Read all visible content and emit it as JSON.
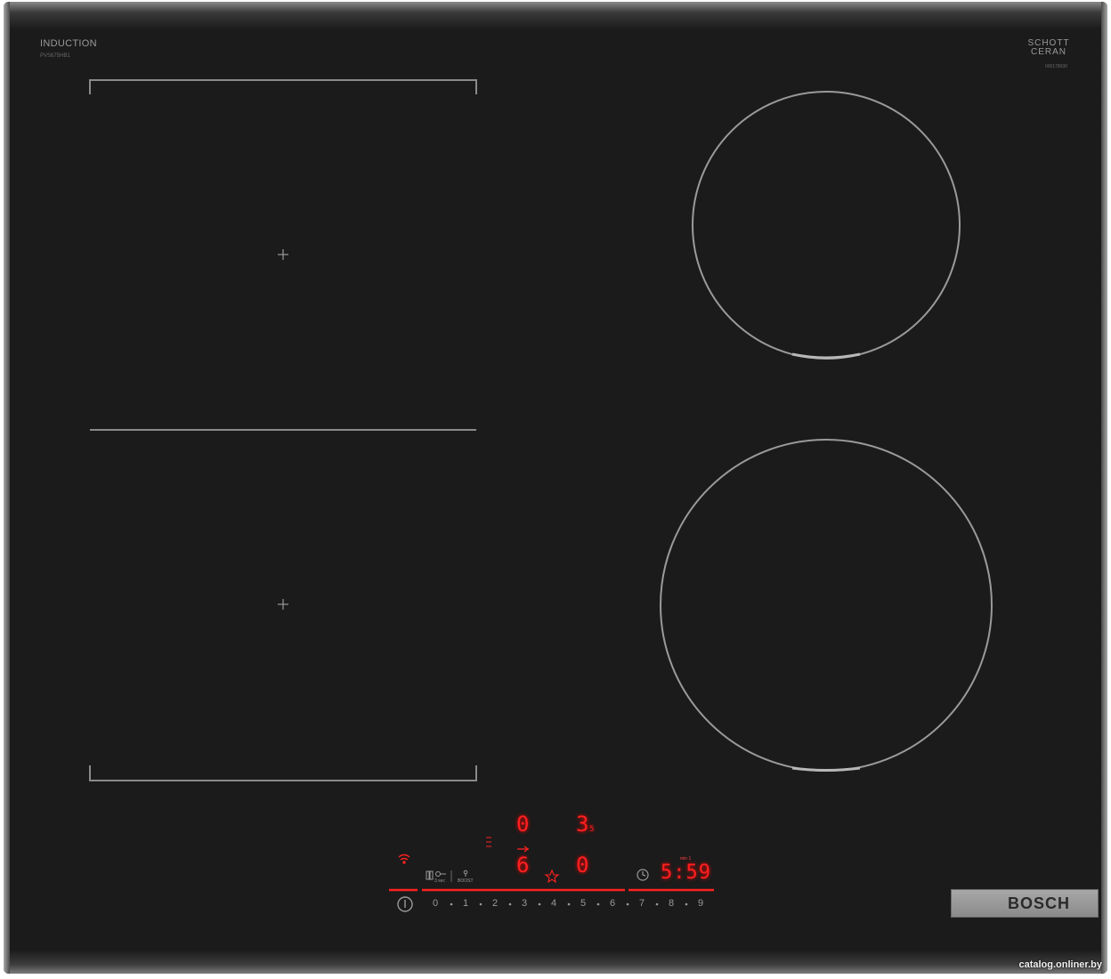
{
  "hob": {
    "type_label": "INDUCTION",
    "model_label": "PVS675HB1",
    "glass_brand": "SCHOTT CERAN",
    "glass_code": "000178030",
    "brand_badge": "BOSCH"
  },
  "controls": {
    "display_top_left": "0",
    "display_top_right": "3",
    "display_top_right_small": "5",
    "display_bottom_left": "6",
    "display_bottom_right": "0",
    "timer_display": "5:59",
    "timer_label": "min 1",
    "lock_label": "3 sec",
    "boost_label": "BOOST",
    "power_scale": [
      "0",
      "1",
      "2",
      "3",
      "4",
      "5",
      "6",
      "7",
      "8",
      "9"
    ]
  },
  "watermark": "catalog.onliner.by",
  "colors": {
    "glass": "#1b1b1b",
    "frame": "#7a7a7a",
    "display_red": "#ff2020"
  }
}
